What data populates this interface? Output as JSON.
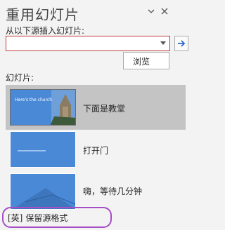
{
  "pane": {
    "title": "重用幻灯片",
    "collapse_icon": "chevron-down-icon",
    "close_icon": "close-icon"
  },
  "source": {
    "label": "从以下源插入幻灯片:",
    "value": "",
    "go_icon": "arrow-right-icon",
    "browse_label": "浏览"
  },
  "slides": {
    "label": "幻灯片:",
    "items": [
      {
        "caption": "下面是教堂",
        "thumb_title": "Here's the church",
        "selected": true
      },
      {
        "caption": "打开门",
        "thumb_title": "",
        "selected": false
      },
      {
        "caption": "嗨，等待几分钟",
        "thumb_title": "",
        "selected": false
      }
    ]
  },
  "keep_format": {
    "checkbox_text": "[英]",
    "label": "保留源格式",
    "checked": false
  },
  "colors": {
    "accent": "#4a89d6",
    "error_border": "#c13b3b",
    "highlight": "#a64ec6",
    "selection": "#c4c4c4"
  }
}
